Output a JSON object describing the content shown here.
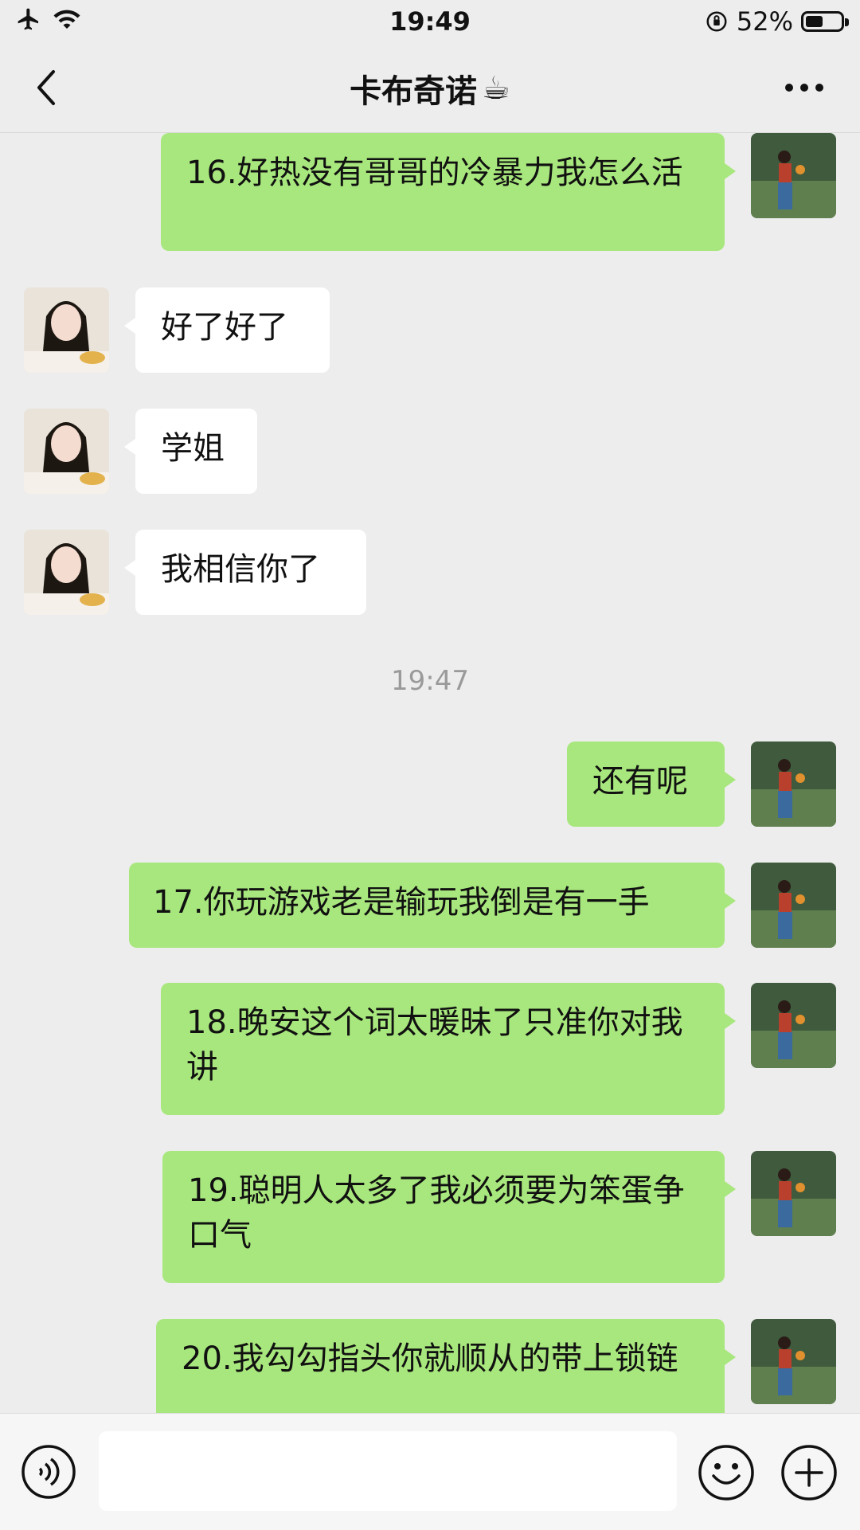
{
  "status": {
    "time": "19:49",
    "battery": "52%",
    "battery_level": 0.52
  },
  "header": {
    "title": "卡布奇诺",
    "title_emoji": "☕",
    "back_icon": "chevron-left-icon",
    "more_icon": "more-icon"
  },
  "messages": [
    {
      "side": "self",
      "text": "16.好热没有哥哥的冷暴力我怎么活"
    },
    {
      "side": "other",
      "text": "好了好了"
    },
    {
      "side": "other",
      "text": "学姐"
    },
    {
      "side": "other",
      "text": "我相信你了"
    },
    {
      "side": "time",
      "text": "19:47"
    },
    {
      "side": "self",
      "text": "还有呢"
    },
    {
      "side": "self",
      "text": "17.你玩游戏老是输玩我倒是有一手"
    },
    {
      "side": "self",
      "text": "18.晚安这个词太暖昧了只准你对我讲"
    },
    {
      "side": "self",
      "text": "19.聪明人太多了我必须要为笨蛋争口气"
    },
    {
      "side": "self",
      "text": "20.我勾勾指头你就顺从的带上锁链"
    }
  ],
  "input": {
    "placeholder": ""
  },
  "colors": {
    "self_bubble": "#a8e77d",
    "other_bubble": "#ffffff",
    "background": "#ededed"
  }
}
